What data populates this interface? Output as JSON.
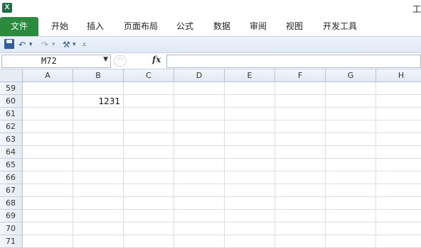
{
  "app": {
    "icon_letter": "X",
    "title_fragment": "工"
  },
  "ribbon": {
    "file_tab": "文件",
    "tabs": [
      "开始",
      "插入",
      "页面布局",
      "公式",
      "数据",
      "审阅",
      "视图",
      "开发工具"
    ]
  },
  "quick_access": {
    "items": [
      "save-icon",
      "undo-icon",
      "redo-icon",
      "tools-icon",
      "customize-icon"
    ],
    "undo_glyph": "↶",
    "redo_glyph": "↷",
    "dropdown_glyph": "▾",
    "tools_glyph": "⚒",
    "customize_glyph": "⩡"
  },
  "formula_bar": {
    "name_box": "M72",
    "name_dropdown_glyph": "▼",
    "cancel_glyph": "◠",
    "fx_label": "fx",
    "formula": ""
  },
  "grid": {
    "columns": [
      "A",
      "B",
      "C",
      "D",
      "E",
      "F",
      "G",
      "H"
    ],
    "rows": [
      "59",
      "60",
      "61",
      "62",
      "63",
      "64",
      "65",
      "66",
      "67",
      "68",
      "69",
      "70",
      "71"
    ],
    "cells": [
      {
        "row": "60",
        "col": "B",
        "value": "1231"
      }
    ]
  }
}
